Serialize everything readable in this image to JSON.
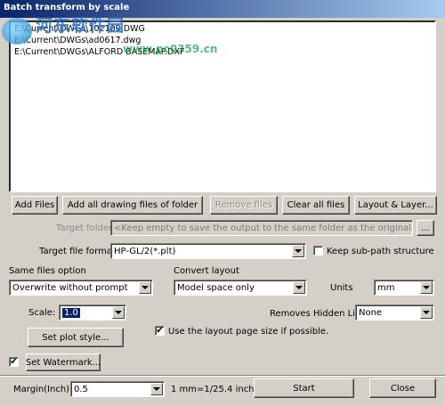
{
  "window": {
    "title": "Batch transform by scale"
  },
  "watermark": {
    "text": "河东软件园",
    "url": "www.pc0359.cn"
  },
  "file_list": [
    "E:\\Current\\DWGs\\102109.DWG",
    "E:\\Current\\DWGs\\ad0617.dwg",
    "E:\\Current\\DWGs\\ALFORD BASEMAP.DXF"
  ],
  "buttons": {
    "add_files": "Add Files",
    "add_folder": "Add all drawing files of folder",
    "remove_files": "Remove files",
    "clear_all": "Clear all files",
    "layout_layer": "Layout & Layer...",
    "browse": "...",
    "set_plot_style": "Set plot style...",
    "set_watermark": "Set Watermark...",
    "start": "Start",
    "close": "Close"
  },
  "target_folder": {
    "label": "Target folder",
    "placeholder": "<Keep empty to save the output to the same folder as the original drawing>"
  },
  "target_format": {
    "label": "Target file format",
    "value": "HP-GL/2(*.plt)"
  },
  "keep_subpath": {
    "label": "Keep sub-path structure",
    "checked": false
  },
  "same_files": {
    "label": "Same files option",
    "value": "Overwrite without prompt"
  },
  "convert_layout": {
    "label": "Convert layout",
    "value": "Model space only"
  },
  "units": {
    "label": "Units",
    "value": "mm"
  },
  "scale": {
    "label": "Scale:",
    "value": "1.0"
  },
  "hidden_line": {
    "label": "Removes Hidden Line",
    "value": "None"
  },
  "layout_page_size": {
    "label": "Use the layout page size if possible.",
    "checked": true
  },
  "watermark_check": {
    "checked": true
  },
  "margin": {
    "label": "Margin(Inch):",
    "value": "0.5"
  },
  "conversion": "1 mm=1/25.4 inch"
}
